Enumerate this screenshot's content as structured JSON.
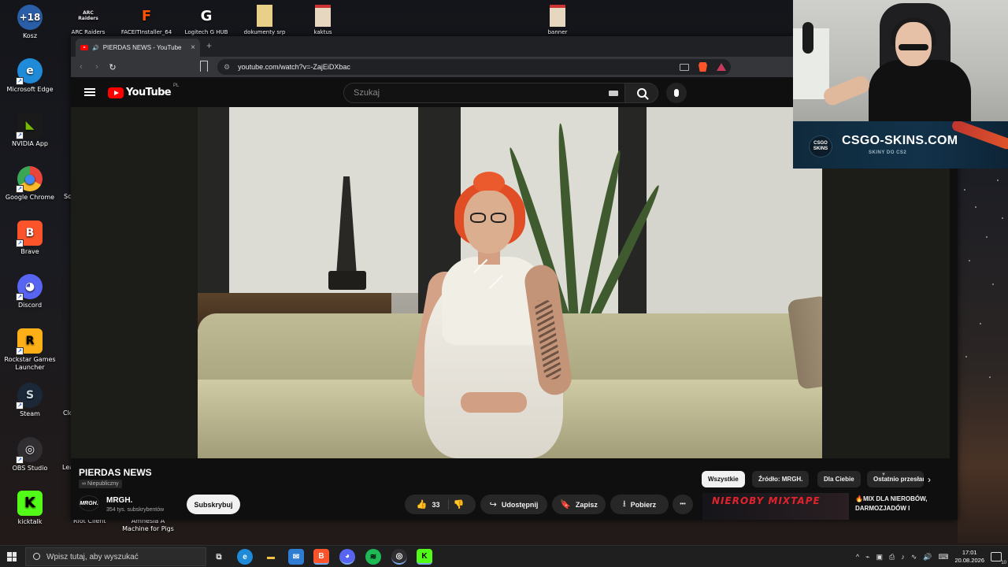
{
  "desktop": {
    "top_icons": [
      {
        "id": "kosz",
        "label": "Kosz",
        "glyph": "+18",
        "color": "#2a5ea8"
      },
      {
        "id": "arc",
        "label": "ARC Raiders",
        "glyph": "ARC Raiders",
        "color": "#15151a"
      },
      {
        "id": "faceit",
        "label": "FACEITInstaller_64",
        "glyph": "F",
        "color": "#ff5500"
      },
      {
        "id": "logitech",
        "label": "Logitech G HUB",
        "glyph": "G",
        "color": "#1a1a1a"
      },
      {
        "id": "dokumenty",
        "label": "dokumenty srp",
        "glyph": "",
        "color": "#e8d088"
      },
      {
        "id": "kaktus",
        "label": "kaktus",
        "glyph": "",
        "color": "#e6d8c0"
      },
      {
        "id": "banner",
        "label": "banner",
        "glyph": "",
        "color": "#e6d8c0"
      }
    ],
    "left_icons": [
      {
        "id": "edge",
        "label": "Microsoft Edge",
        "glyph": "e",
        "color": "#1f8ad8"
      },
      {
        "id": "nvidia",
        "label": "NVIDIA App",
        "glyph": "◣",
        "color": "#76b900"
      },
      {
        "id": "chrome",
        "label": "Google Chrome",
        "glyph": "●",
        "color": "#e8453c"
      },
      {
        "id": "brave",
        "label": "Brave",
        "glyph": "B",
        "color": "#fb542b"
      },
      {
        "id": "discord",
        "label": "Discord",
        "glyph": "◕",
        "color": "#5865f2"
      },
      {
        "id": "rockstar",
        "label": "Rockstar Games Launcher",
        "glyph": "R",
        "color": "#fcaf17"
      },
      {
        "id": "steam",
        "label": "Steam",
        "glyph": "S",
        "color": "#1b2838"
      },
      {
        "id": "obs",
        "label": "OBS Studio",
        "glyph": "◎",
        "color": "#302e31"
      },
      {
        "id": "kicktalk",
        "label": "kicktalk",
        "glyph": "K",
        "color": "#53fc18"
      }
    ],
    "second_column_labels": [
      "Sc",
      "Clo",
      "Lea"
    ],
    "bottom_second_column": [
      {
        "id": "riot",
        "label": "Riot Client"
      },
      {
        "id": "amnesia",
        "label": "Amnesia A Machine for Pigs"
      }
    ]
  },
  "browser": {
    "tab_title": "PIERDAS NEWS - YouTube",
    "tab_audio": "🔊",
    "tab_close": "×",
    "new_tab": "+",
    "nav_back": "‹",
    "nav_forward": "›",
    "reload": "↻",
    "url": "youtube.com/watch?v=-ZajEiDXbac",
    "brave_count": "18"
  },
  "youtube": {
    "logo_text": "YouTube",
    "region": "PL",
    "search_placeholder": "Szukaj",
    "video": {
      "title": "PIERDAS NEWS",
      "visibility": "Niepubliczny",
      "visibility_icon": "∞"
    },
    "channel": {
      "avatar_text": "MRGH.",
      "name": "MRGH.",
      "subscribers": "354 tys. subskrybentów",
      "subscribe_label": "Subskrybuj"
    },
    "actions": {
      "like_icon": "👍",
      "like_count": "33",
      "dislike_icon": "👎",
      "share_icon": "↪",
      "share_label": "Udostępnij",
      "save_icon": "🔖",
      "save_label": "Zapisz",
      "download_icon": "⭳",
      "download_label": "Pobierz",
      "more_icon": "•••"
    },
    "chips": [
      "Wszystkie",
      "Źródło: MRGH.",
      "Dla Ciebie",
      "Ostatnio przesłane"
    ],
    "chip_next": "›",
    "recommended": {
      "thumb_text": "NIEROBY MIXTAPE",
      "title": "🔥MIX DLA NIEROBÓW, DARMOZJADÓW I NIEROBASÓW"
    }
  },
  "overlay": {
    "ad_logo": "CSGO SKINS",
    "ad_title": "CSGO-SKINS.COM",
    "ad_subtitle": "SKINY DO CS2"
  },
  "taskbar": {
    "search_placeholder": "Wpisz tutaj, aby wyszukać",
    "apps": [
      {
        "id": "taskview",
        "glyph": "⧉",
        "color": "transparent"
      },
      {
        "id": "edge",
        "glyph": "e",
        "color": "#1f8ad8"
      },
      {
        "id": "explorer",
        "glyph": "▬",
        "color": "#f4c542"
      },
      {
        "id": "mail",
        "glyph": "✉",
        "color": "#2f7cd3"
      },
      {
        "id": "brave",
        "glyph": "B",
        "color": "#fb542b"
      },
      {
        "id": "discord",
        "glyph": "◕",
        "color": "#5865f2"
      },
      {
        "id": "spotify",
        "glyph": "≋",
        "color": "#1db954"
      },
      {
        "id": "obs",
        "glyph": "◎",
        "color": "#302e31"
      },
      {
        "id": "kicktalk",
        "glyph": "K",
        "color": "#53fc18"
      }
    ],
    "tray_icons": [
      "^",
      "⌁",
      "▣",
      "⎙",
      "♪",
      "∿",
      "🔊",
      "⌨"
    ],
    "time": "17:01",
    "date": "20.08.2026",
    "notifications": "10"
  }
}
